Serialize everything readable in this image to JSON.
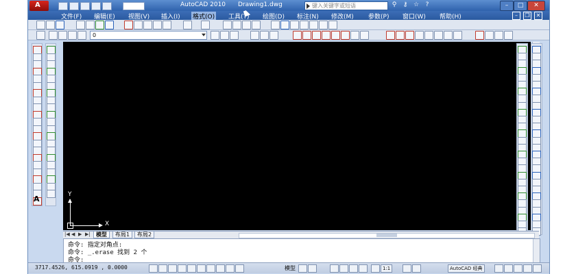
{
  "titlebar": {
    "app_title": "AutoCAD 2010",
    "document_title": "Drawing1.dwg",
    "search_placeholder": "键入关键字或短语",
    "logo_letter": "A"
  },
  "menu": {
    "items": [
      "文件(F)",
      "编辑(E)",
      "视图(V)",
      "插入(I)",
      "格式(O)",
      "工具(T)",
      "绘图(D)",
      "标注(N)",
      "修改(M)",
      "参数(P)",
      "窗口(W)",
      "帮助(H)"
    ],
    "active_index": 4
  },
  "layer": {
    "current": "0"
  },
  "canvas": {
    "background": "#000000",
    "ucs_y_label": "Y",
    "ucs_x_label": "X"
  },
  "tabs": {
    "items": [
      "模型",
      "布局1",
      "布局2"
    ],
    "active_index": 0
  },
  "command": {
    "lines": [
      "命令: 指定对角点:",
      "命令: _.erase 找到 2 个",
      "命令:"
    ]
  },
  "status": {
    "coords": "3717.4526, 615.0919 , 0.0000",
    "model_label": "模型",
    "scale": "1:1",
    "workspace": "AutoCAD 经典"
  },
  "icons": {
    "text_tool_glyph": "A",
    "left_draw_toolbar_count": 22,
    "left_modify_toolbar_count": 21,
    "right_toolbar_count": 27
  }
}
